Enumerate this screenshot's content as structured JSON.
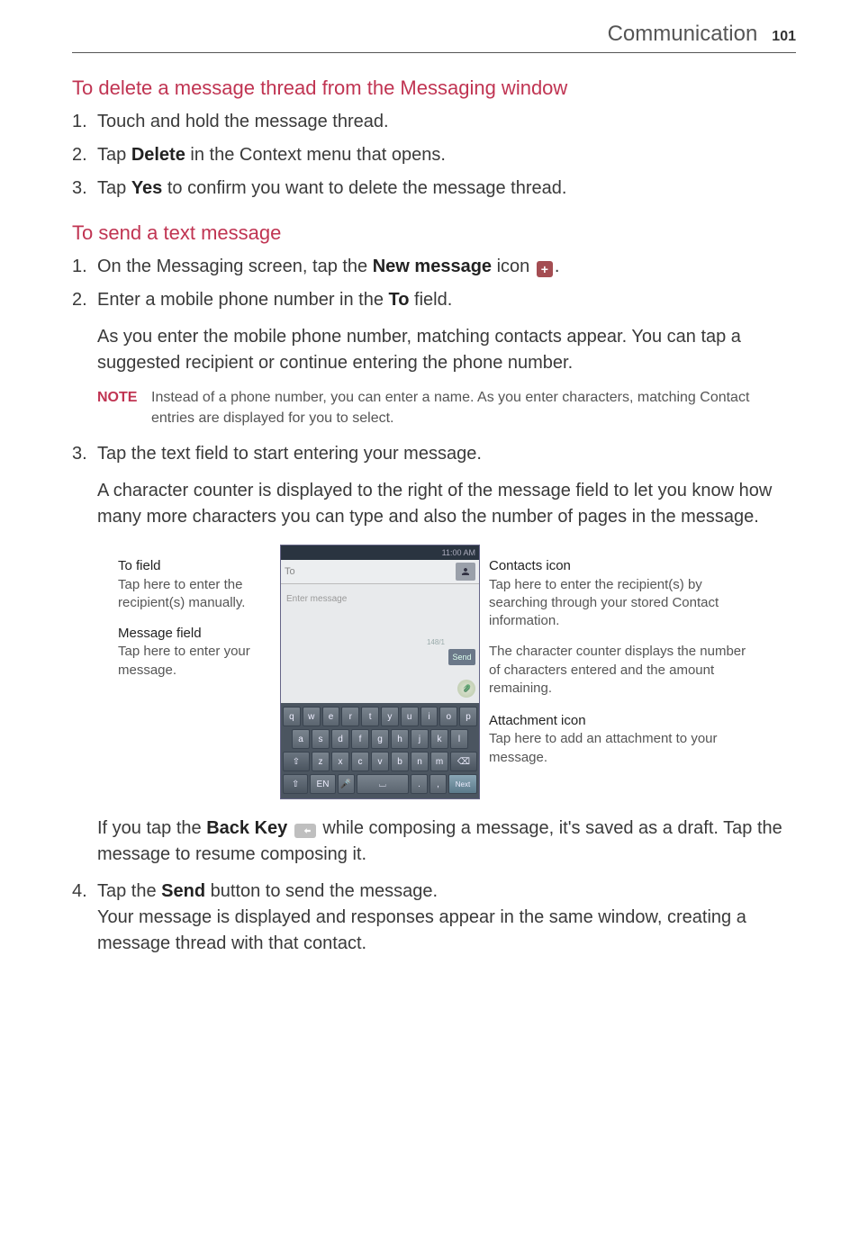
{
  "header": {
    "title": "Communication",
    "page_number": "101"
  },
  "section1": {
    "heading": "To delete a message thread from the Messaging window",
    "items": [
      {
        "n": "1.",
        "text": "Touch and hold the message thread."
      },
      {
        "n": "2.",
        "pre": "Tap ",
        "bold": "Delete",
        "post": " in the Context menu that opens."
      },
      {
        "n": "3.",
        "pre": "Tap ",
        "bold": "Yes",
        "post": " to confirm you want to delete the message thread."
      }
    ]
  },
  "section2": {
    "heading": "To send a text message",
    "item1": {
      "n": "1.",
      "pre": "On the Messaging screen, tap the ",
      "bold": "New message",
      "mid": " icon ",
      "post": "."
    },
    "item2": {
      "n": "2.",
      "pre": "Enter a mobile phone number in the ",
      "bold": "To",
      "post": " field."
    },
    "para2a": "As you enter the mobile phone number, matching contacts appear. You can tap a suggested recipient or continue entering the phone number.",
    "note": {
      "label": "NOTE",
      "text": "Instead of a phone number, you can enter a name. As you enter characters, matching Contact entries are displayed for you to select."
    },
    "item3": {
      "n": "3.",
      "text": "Tap the text field to start entering your message."
    },
    "para3a": "A character counter is displayed to the right of the message field to let you know how many more characters you can type and also the number of pages in the message.",
    "figure": {
      "left": {
        "to_field": {
          "title": "To field",
          "desc": "Tap here to enter the recipient(s) manually."
        },
        "msg_field": {
          "title": "Message field",
          "desc": "Tap here to enter your message."
        }
      },
      "right": {
        "contacts": {
          "title": "Contacts icon",
          "desc": "Tap here to enter the recipient(s) by searching through your stored Contact information."
        },
        "counter": {
          "desc": "The character counter displays the number of characters entered and the amount remaining."
        },
        "attach": {
          "title": "Attachment icon",
          "desc": "Tap here to add an attachment to your message."
        }
      },
      "phone": {
        "status_time": "11:00 AM",
        "to_placeholder": "To",
        "msg_placeholder": "Enter message",
        "counter_text": "148/1",
        "send_label": "Send",
        "next_label": "Next",
        "keys_row1": [
          "q",
          "w",
          "e",
          "r",
          "t",
          "y",
          "u",
          "i",
          "o",
          "p"
        ],
        "keys_row2": [
          "a",
          "s",
          "d",
          "f",
          "g",
          "h",
          "j",
          "k",
          "l"
        ],
        "keys_row3": [
          "z",
          "x",
          "c",
          "v",
          "b",
          "n",
          "m"
        ]
      }
    },
    "after_fig": {
      "pre": "If you tap the ",
      "bold": "Back Key",
      "mid": " ",
      "post": " while composing a message, it's saved as a draft. Tap the message to resume composing it."
    },
    "item4": {
      "n": "4.",
      "pre": "Tap the ",
      "bold": "Send",
      "post": " button to send the message.",
      "para": "Your message is displayed and responses appear in the same window, creating a message thread with that contact."
    }
  }
}
